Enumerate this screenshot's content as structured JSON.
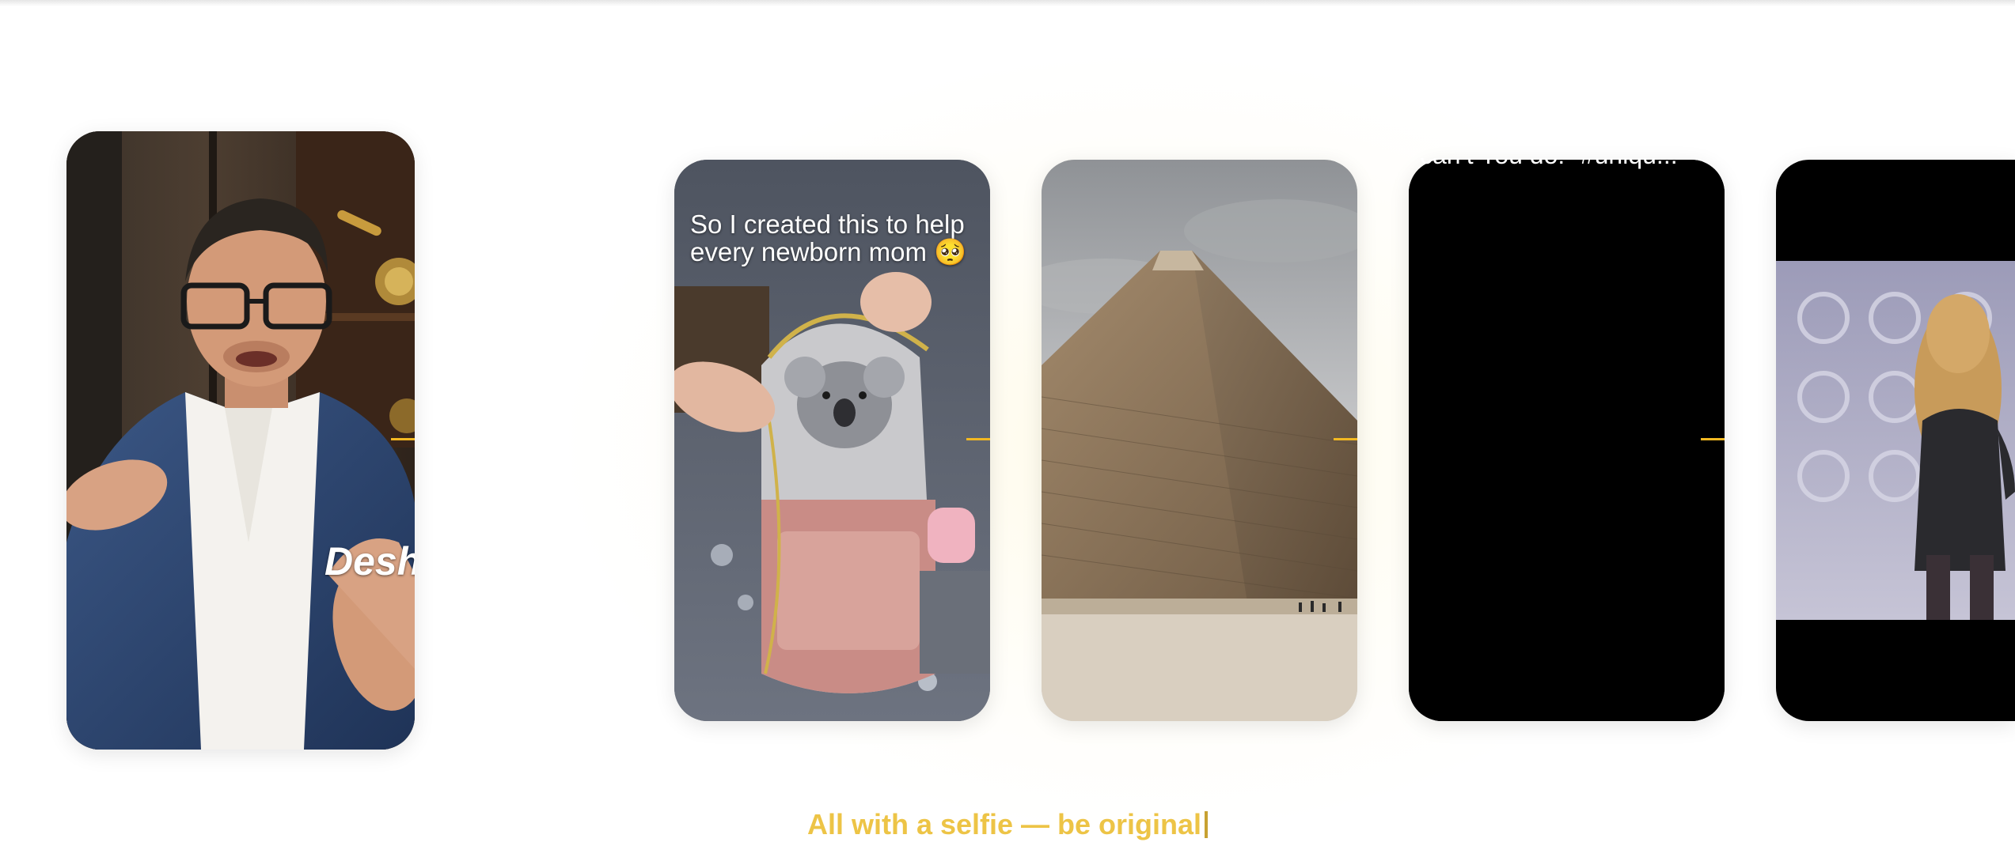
{
  "cards": [
    {
      "name": "presenter-video",
      "overlay": "Desh"
    },
    {
      "name": "diaper-bag-video",
      "caption_line1": "So I created this to help",
      "caption_line2": "every newborn mom 🥺"
    },
    {
      "name": "pyramid-video"
    },
    {
      "name": "black-video",
      "caption": "can’t You do!” #uniqu..."
    },
    {
      "name": "dancer-video"
    }
  ],
  "tagline": "All with a selfie — be original",
  "colors": {
    "accent": "#f2b822",
    "tagline": "#edc446"
  }
}
